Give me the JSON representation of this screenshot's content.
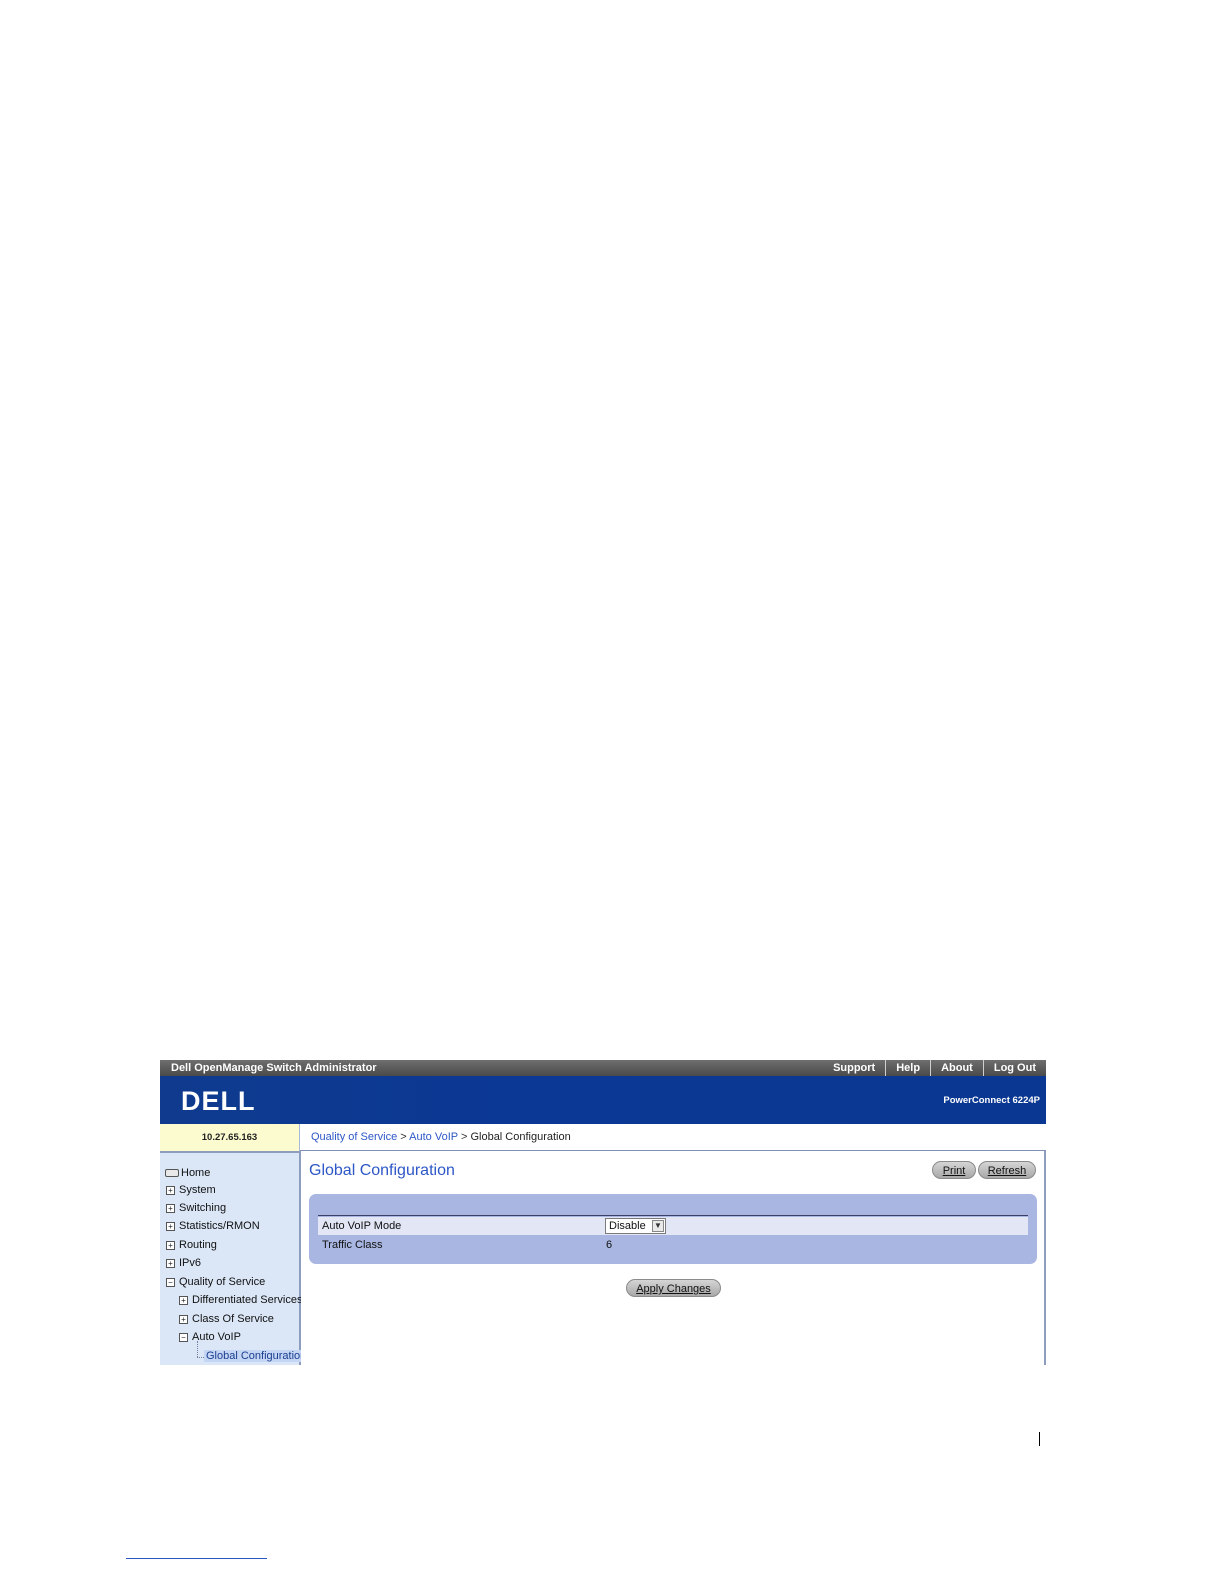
{
  "topbar": {
    "app_title": "Dell OpenManage Switch Administrator",
    "links": [
      "Support",
      "Help",
      "About",
      "Log Out"
    ]
  },
  "brand": {
    "logo_text": "DELL",
    "product": "PowerConnect 6224P",
    "band_color": "#0b3894"
  },
  "ip_address": "10.27.65.163",
  "breadcrumb": {
    "items": [
      "Quality of Service",
      "Auto VoIP"
    ],
    "separator": ">",
    "current": "Global Configuration"
  },
  "sidebar": {
    "home": "Home",
    "items": [
      "System",
      "Switching",
      "Statistics/RMON",
      "Routing",
      "IPv6",
      "Quality of Service"
    ],
    "qos_children": [
      "Differentiated Services",
      "Class Of Service",
      "Auto VoIP"
    ],
    "voip_children": [
      "Global Configuration"
    ]
  },
  "main": {
    "title": "Global Configuration",
    "print_label": "Print",
    "refresh_label": "Refresh",
    "rows": [
      {
        "label": "Auto VoIP Mode",
        "value": "Disable"
      },
      {
        "label": "Traffic Class",
        "value": "6"
      }
    ],
    "mode_options": [
      "Disable"
    ],
    "apply_label": "Apply Changes"
  },
  "colors": {
    "accent_blue": "#2d57c7",
    "panel_bg": "#a9b6e2",
    "sidebar_bg": "#dbe7f7",
    "ip_bg": "#fbfbcf"
  }
}
